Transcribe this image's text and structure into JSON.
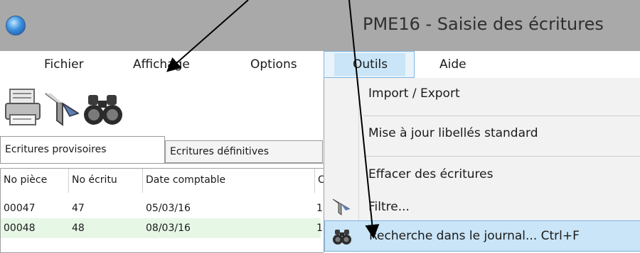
{
  "window": {
    "title": "PME16 - Saisie des écritures"
  },
  "menu": {
    "items": [
      {
        "label": "Fichier"
      },
      {
        "label": "Affichage"
      },
      {
        "label": "Options"
      },
      {
        "label": "Outils"
      },
      {
        "label": "Aide"
      }
    ],
    "active": "Outils"
  },
  "toolbar": {
    "icons": [
      "printer-icon",
      "filter-funnel-icon",
      "binoculars-icon"
    ]
  },
  "tabs": [
    {
      "label": "Ecritures provisoires",
      "selected": true
    },
    {
      "label": "Ecritures définitives",
      "selected": false
    }
  ],
  "table": {
    "columns": [
      "No pièce",
      "No écritu",
      "Date comptable",
      "C"
    ],
    "rows": [
      [
        "00047",
        "47",
        "05/03/16",
        "1"
      ],
      [
        "00048",
        "48",
        "08/03/16",
        "1"
      ]
    ]
  },
  "outils_menu": {
    "items": [
      {
        "label": "Import / Export",
        "icon": ""
      },
      {
        "label": "Mise à jour libellés standard",
        "icon": ""
      },
      {
        "label": "Effacer des écritures",
        "icon": ""
      },
      {
        "label": "Filtre...",
        "icon": "filter-funnel-icon"
      },
      {
        "label": "Recherche dans le journal...  Ctrl+F",
        "icon": "binoculars-icon",
        "highlighted": true
      }
    ]
  },
  "colors": {
    "titlebar": "#a9a9a9",
    "menu_highlight": "#c9e5f7",
    "menu_highlight_border": "#7fb6e0",
    "row_alt": "#e6f7e6",
    "dropdown_bg": "#f2f2f2"
  }
}
